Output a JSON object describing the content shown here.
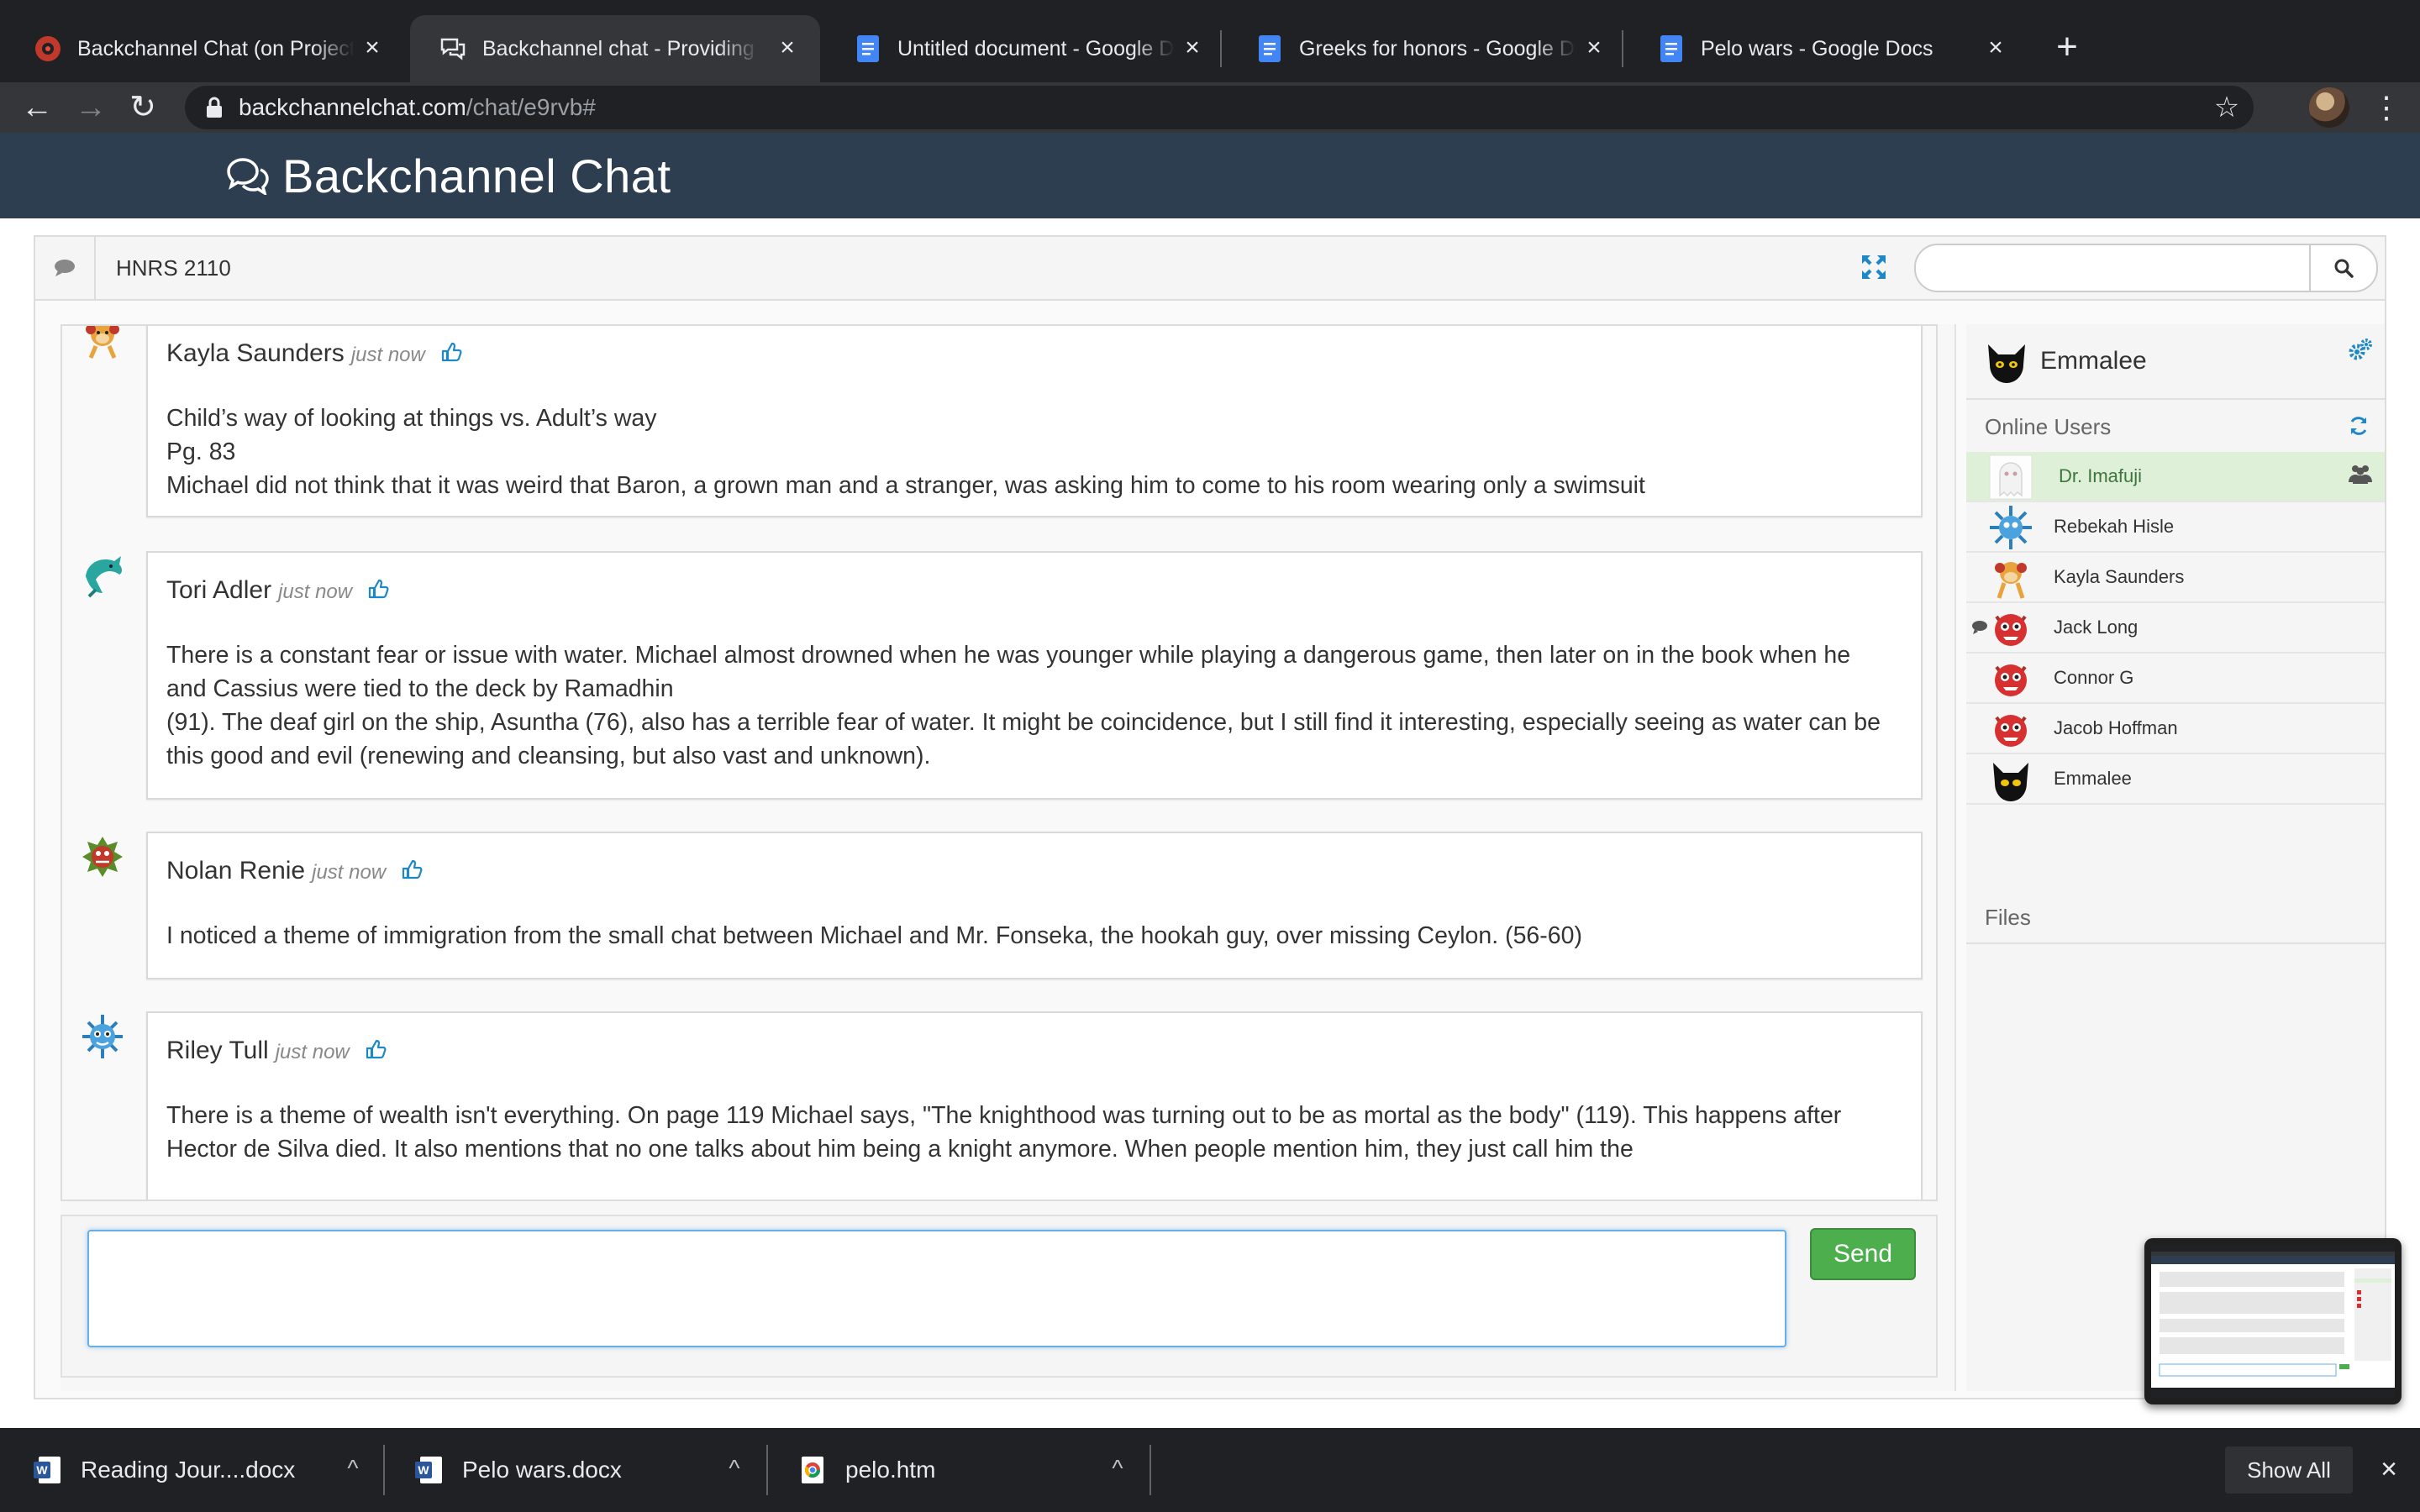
{
  "browser": {
    "tabs": [
      {
        "title": "Backchannel Chat (on Projector)",
        "icon": "backchannel-favicon"
      },
      {
        "title": "Backchannel chat - Providing a",
        "icon": "chat-bubbles-favicon"
      },
      {
        "title": "Untitled document - Google Docs",
        "icon": "google-docs-favicon"
      },
      {
        "title": "Greeks for honors - Google Docs",
        "icon": "google-docs-favicon"
      },
      {
        "title": "Pelo wars - Google Docs",
        "icon": "google-docs-favicon"
      }
    ],
    "active_tab_index": 1,
    "url_host": "backchannelchat.com",
    "url_path": "/chat/e9rvb#"
  },
  "app": {
    "brand": "Backchannel Chat",
    "room": "HNRS 2110",
    "search_placeholder": ""
  },
  "messages": [
    {
      "author": "Kayla Saunders",
      "time": "just now",
      "avatar": "monkey-avatar",
      "lines": [
        "Child’s way of looking at things vs. Adult’s way",
        "Pg. 83",
        "Michael did not think that it was weird that Baron, a grown man and a stranger, was asking him to come to his room wearing only a swimsuit"
      ]
    },
    {
      "author": "Tori Adler",
      "time": "just now",
      "avatar": "dolphin-avatar",
      "lines": [
        "There is a constant fear or issue with water. Michael almost drowned when he was younger while playing a dangerous game, then later on in the book when he and Cassius were tied to the deck by Ramadhin",
        "(91). The deaf girl on the ship, Asuntha (76), also has a terrible fear of water. It might be coincidence, but I still find it interesting, especially seeing as water can be this good and evil (renewing and cleansing, but also vast and unknown)."
      ]
    },
    {
      "author": "Nolan Renie",
      "time": "just now",
      "avatar": "plant-monster-avatar",
      "lines": [
        "I noticed a theme of immigration from the small chat between Michael and Mr. Fonseka, the hookah guy, over missing Ceylon. (56-60)"
      ]
    },
    {
      "author": "Riley Tull",
      "time": "just now",
      "avatar": "virus-avatar",
      "lines": [
        "There is a theme of wealth isn't everything. On page 119 Michael says, \"The knighthood was turning out to be as mortal as the body\" (119). This happens after Hector de Silva died. It also mentions that no one talks about him being a knight anymore. When people mention him, they just call him the"
      ]
    }
  ],
  "compose": {
    "value": "",
    "send_label": "Send"
  },
  "sidebar": {
    "me": {
      "name": "Emmalee",
      "avatar": "black-cat-avatar"
    },
    "online_label": "Online Users",
    "users": [
      {
        "name": "Dr. Imafuji",
        "avatar": "ghost-avatar",
        "highlight": true
      },
      {
        "name": "Rebekah Hisle",
        "avatar": "virus-avatar"
      },
      {
        "name": "Kayla Saunders",
        "avatar": "monkey-avatar"
      },
      {
        "name": "Jack Long",
        "avatar": "red-monster-avatar",
        "chatting": true
      },
      {
        "name": "Connor G",
        "avatar": "red-monster-avatar"
      },
      {
        "name": "Jacob Hoffman",
        "avatar": "red-monster-avatar"
      },
      {
        "name": "Emmalee",
        "avatar": "black-cat-avatar"
      }
    ],
    "files_label": "Files"
  },
  "downloads": [
    {
      "name": "Reading Jour....docx",
      "icon": "word-doc-icon"
    },
    {
      "name": "Pelo wars.docx",
      "icon": "word-doc-icon"
    },
    {
      "name": "pelo.htm",
      "icon": "chrome-html-icon"
    }
  ],
  "downloads_show_all": "Show All",
  "colors": {
    "app_header": "#2c3e50",
    "send_button": "#4cae4c",
    "highlight_user": "#dff0d8",
    "link_blue": "#1e88c7"
  }
}
